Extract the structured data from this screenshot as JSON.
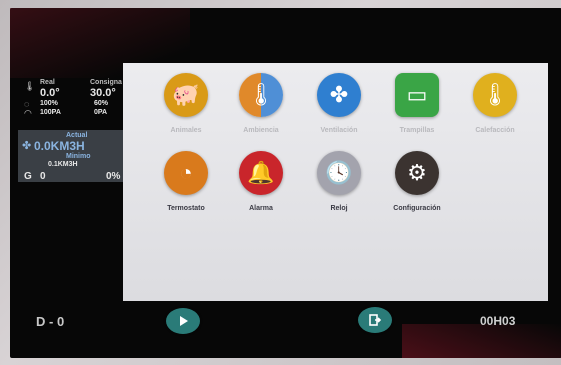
{
  "sidebar": {
    "temperature": {
      "real_label": "Real",
      "consigna_label": "Consigna",
      "real_value": "0.0°",
      "consigna_value": "30.0°"
    },
    "humidity": {
      "real": "100%",
      "consigna": "60%"
    },
    "pressure": {
      "real": "100PA",
      "consigna": "0PA"
    },
    "ventilation": {
      "actual_label": "Actual",
      "actual_value": "0.0KM3H",
      "minimo_label": "Minimo",
      "minimo_value": "0.1KM3H",
      "g_label": "G",
      "g_value": "0",
      "g_percent": "0%"
    }
  },
  "menu": [
    {
      "label": "Animales",
      "icon": "pig-icon",
      "color": "#d99a17"
    },
    {
      "label": "Ambiencia",
      "icon": "thermometer-icon",
      "color": "#e0892a"
    },
    {
      "label": "Ventilación",
      "icon": "fan-icon",
      "color": "#2f7fd0"
    },
    {
      "label": "Trampillas",
      "icon": "window-icon",
      "color": "#3aa546"
    },
    {
      "label": "Calefacción",
      "icon": "thermometer-icon",
      "color": "#e0b01e"
    },
    {
      "label": "Termostato",
      "icon": "dial-icon",
      "color": "#d97a1c"
    },
    {
      "label": "Alarma",
      "icon": "bell-icon",
      "color": "#c9252b"
    },
    {
      "label": "Reloj",
      "icon": "clock-icon",
      "color": "#a3a3ad"
    },
    {
      "label": "Configuración",
      "icon": "gears-icon",
      "color": "#3b3330"
    }
  ],
  "bottom": {
    "d_label": "D - 0",
    "timer": "00H03",
    "play_icon": "play-icon",
    "exit_icon": "exit-icon",
    "button_color": "#2a7b78"
  }
}
